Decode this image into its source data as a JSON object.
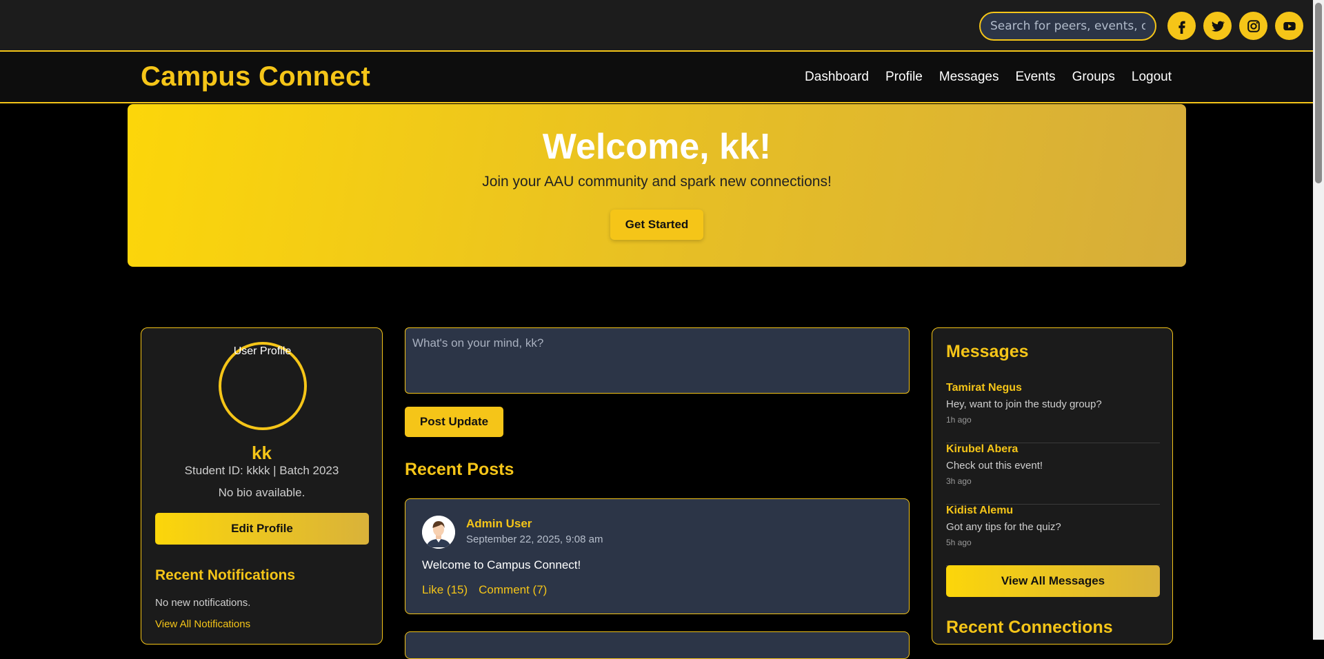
{
  "topbar": {
    "search_placeholder": "Search for peers, events, or groups...",
    "social": [
      "facebook-icon",
      "twitter-icon",
      "instagram-icon",
      "youtube-icon"
    ]
  },
  "nav": {
    "brand": "Campus Connect",
    "links": [
      "Dashboard",
      "Profile",
      "Messages",
      "Events",
      "Groups",
      "Logout"
    ]
  },
  "hero": {
    "title": "Welcome, kk!",
    "subtitle": "Join your AAU community and spark new connections!",
    "cta": "Get Started"
  },
  "profile": {
    "avatar_alt": "User Profile",
    "name": "kk",
    "student_line": "Student ID: kkkk | Batch 2023",
    "bio": "No bio available.",
    "edit_label": "Edit Profile",
    "notifications_title": "Recent Notifications",
    "notifications_empty": "No new notifications.",
    "notifications_link": "View All Notifications"
  },
  "feed": {
    "composer_placeholder": "What's on your mind, kk?",
    "post_button": "Post Update",
    "recent_title": "Recent Posts",
    "posts": [
      {
        "author": "Admin User",
        "date": "September 22, 2025, 9:08 am",
        "text": "Welcome to Campus Connect!",
        "like": "Like (15)",
        "comment": "Comment (7)"
      }
    ]
  },
  "messages": {
    "title": "Messages",
    "items": [
      {
        "name": "Tamirat Negus",
        "text": "Hey, want to join the study group?",
        "time": "1h ago"
      },
      {
        "name": "Kirubel Abera",
        "text": "Check out this event!",
        "time": "3h ago"
      },
      {
        "name": "Kidist Alemu",
        "text": "Got any tips for the quiz?",
        "time": "5h ago"
      }
    ],
    "view_all": "View All Messages",
    "connections_title": "Recent Connections"
  },
  "colors": {
    "accent": "#f5c518",
    "panel": "#1b1b1b",
    "card": "#2c3547",
    "background": "#000000"
  }
}
